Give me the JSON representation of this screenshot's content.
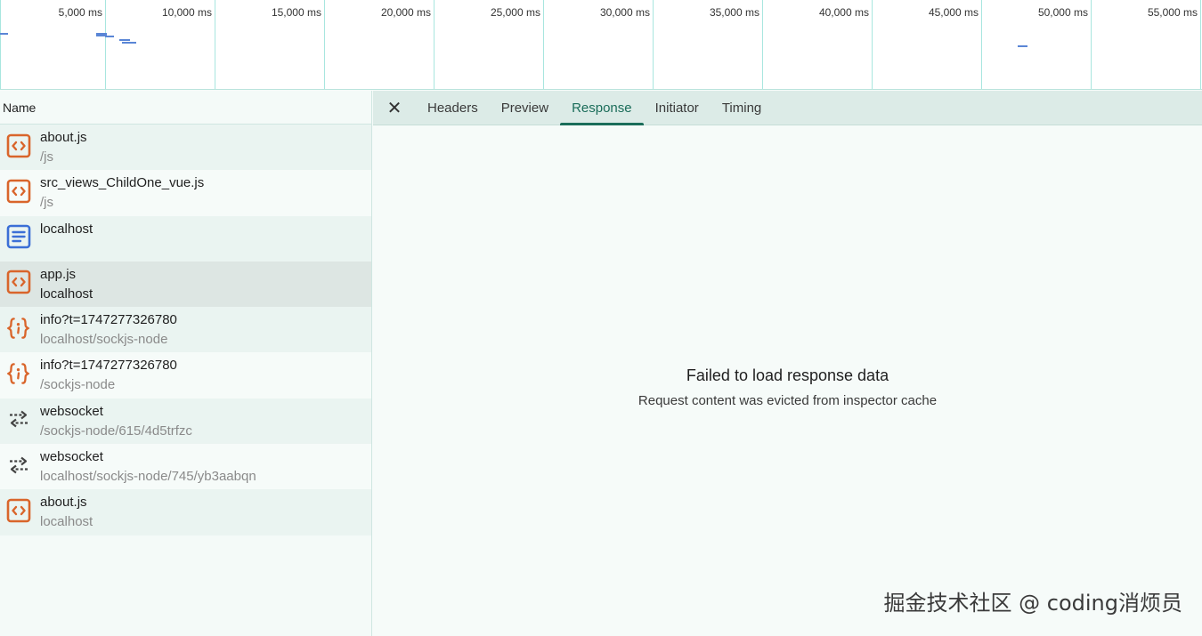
{
  "timeline": {
    "ticks": [
      "5,000 ms",
      "10,000 ms",
      "15,000 ms",
      "20,000 ms",
      "25,000 ms",
      "30,000 ms",
      "35,000 ms",
      "40,000 ms",
      "45,000 ms",
      "50,000 ms",
      "55,000 ms"
    ]
  },
  "list": {
    "header": "Name",
    "rows": [
      {
        "name": "about.js",
        "path": "/js",
        "icon": "script-icon"
      },
      {
        "name": "src_views_ChildOne_vue.js",
        "path": "/js",
        "icon": "script-icon"
      },
      {
        "name": "localhost",
        "path": "",
        "icon": "document-icon"
      },
      {
        "name": "app.js",
        "path": "localhost",
        "icon": "script-icon",
        "selected": true
      },
      {
        "name": "info?t=1747277326780",
        "path": "localhost/sockjs-node",
        "icon": "json-icon"
      },
      {
        "name": "info?t=1747277326780",
        "path": "/sockjs-node",
        "icon": "json-icon"
      },
      {
        "name": "websocket",
        "path": "/sockjs-node/615/4d5trfzc",
        "icon": "websocket-icon"
      },
      {
        "name": "websocket",
        "path": "localhost/sockjs-node/745/yb3aabqn",
        "icon": "websocket-icon"
      },
      {
        "name": "about.js",
        "path": "localhost",
        "icon": "script-icon"
      }
    ]
  },
  "detail": {
    "close_label": "✕",
    "tabs": [
      "Headers",
      "Preview",
      "Response",
      "Initiator",
      "Timing"
    ],
    "active_tab": "Response",
    "empty_title": "Failed to load response data",
    "empty_sub": "Request content was evicted from inspector cache"
  },
  "watermark": "掘金技术社区 @ coding消烦员",
  "colors": {
    "accent": "#1b6d5a",
    "script": "#d9652b",
    "document": "#3b6fd6",
    "timeline_bar": "#5a86d6"
  }
}
